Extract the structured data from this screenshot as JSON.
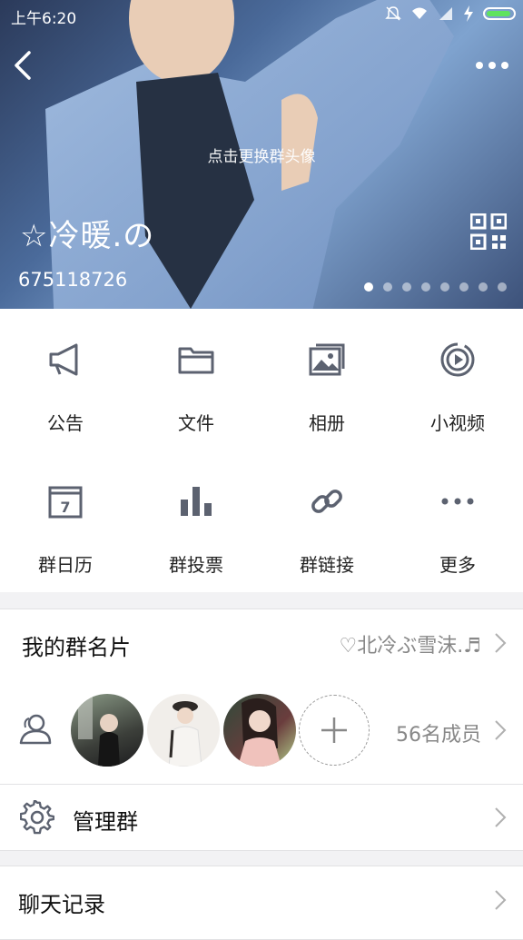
{
  "status_bar": {
    "time": "上午6:20"
  },
  "header": {
    "change_avatar_hint": "点击更换群头像",
    "group_name": "☆冷暖.の",
    "group_id": "675118726",
    "page_dots_total": 8,
    "page_dots_active": 1
  },
  "functions": [
    {
      "label": "公告",
      "icon": "megaphone-icon"
    },
    {
      "label": "文件",
      "icon": "folder-icon"
    },
    {
      "label": "相册",
      "icon": "album-icon"
    },
    {
      "label": "小视频",
      "icon": "video-icon"
    },
    {
      "label": "群日历",
      "icon": "calendar-icon"
    },
    {
      "label": "群投票",
      "icon": "vote-icon"
    },
    {
      "label": "群链接",
      "icon": "link-icon"
    },
    {
      "label": "更多",
      "icon": "more-icon"
    }
  ],
  "card": {
    "title": "我的群名片",
    "value": "♡北冷ぶ雪沫.♬"
  },
  "members": {
    "count_text": "56名成员"
  },
  "manage": {
    "title": "管理群"
  },
  "history": {
    "title": "聊天记录"
  },
  "colors": {
    "icon_gray": "#5c6270",
    "battery_green": "#5fe35f"
  }
}
